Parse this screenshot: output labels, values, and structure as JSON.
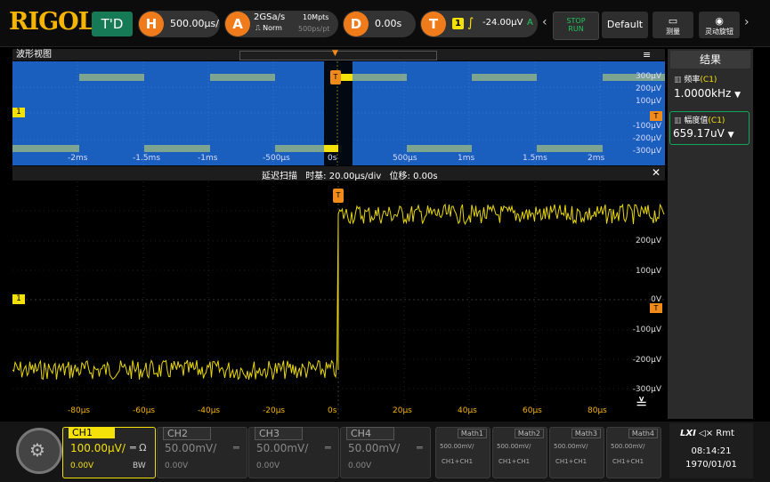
{
  "top": {
    "logo": "RIGOL",
    "td_label": "T'D",
    "horizontal": {
      "badge": "H",
      "value": "500.00μs/"
    },
    "acquire": {
      "badge": "A",
      "sample_rate": "2GSa/s",
      "mode": "Norm",
      "depth": "10Mpts",
      "per_pt": "500ps/pt"
    },
    "delay": {
      "badge": "D",
      "value": "0.00s"
    },
    "trigger": {
      "badge": "T",
      "source": "1",
      "level": "-24.00μV",
      "mode_letter": "A"
    },
    "stop_run": {
      "line1": "STOP",
      "line2": "RUN"
    },
    "default_label": "Default",
    "measure_label": "测量",
    "knob_label": "灵动旋钮",
    "colors": {
      "ch1": "#f5e10a",
      "trigger": "#f08a1a",
      "brand": "#f5b400",
      "overview_bg": "#1a5fbe",
      "measure_green": "#12a65a"
    }
  },
  "overview": {
    "title": "波形视图",
    "x_labels": [
      "-2ms",
      "-1.5ms",
      "-1ms",
      "-500μs",
      "0s",
      "500μs",
      "1ms",
      "1.5ms",
      "2ms"
    ],
    "y_labels": [
      "300μV",
      "200μV",
      "100μV",
      "-100μV",
      "-200μV",
      "-300μV"
    ],
    "ch_marker": "1",
    "trig_marker": "T"
  },
  "zoom": {
    "title": "延迟扫描",
    "timebase": "时基: 20.00μs/div",
    "offset": "位移: 0.00s",
    "x_labels": [
      "-80μs",
      "-60μs",
      "-40μs",
      "-20μs",
      "0s",
      "20μs",
      "40μs",
      "60μs",
      "80μs"
    ],
    "y_labels": [
      "200μV",
      "100μV",
      "0V",
      "-100μV",
      "-200μV",
      "-300μV"
    ],
    "ch_marker": "1",
    "trig_marker": "T"
  },
  "results": {
    "title": "结果",
    "items": [
      {
        "label": "频率",
        "src": "(C1)",
        "value": "1.0000kHz"
      },
      {
        "label": "幅度值",
        "src": "(C1)",
        "value": "659.17uV"
      }
    ]
  },
  "channels": [
    {
      "name": "CH1",
      "scale": "100.00μV/",
      "coupling": "═ Ω",
      "offset": "0.00V",
      "extra": "BW"
    },
    {
      "name": "CH2",
      "scale": "50.00mV/",
      "coupling": "═",
      "offset": "0.00V",
      "extra": ""
    },
    {
      "name": "CH3",
      "scale": "50.00mV/",
      "coupling": "═",
      "offset": "0.00V",
      "extra": ""
    },
    {
      "name": "CH4",
      "scale": "50.00mV/",
      "coupling": "═",
      "offset": "0.00V",
      "extra": ""
    }
  ],
  "maths": [
    {
      "name": "Math1",
      "scale": "500.00mV/",
      "expr": "CH1+CH1"
    },
    {
      "name": "Math2",
      "scale": "500.00mV/",
      "expr": "CH1+CH1"
    },
    {
      "name": "Math3",
      "scale": "500.00mV/",
      "expr": "CH1+CH1"
    },
    {
      "name": "Math4",
      "scale": "500.00mV/",
      "expr": "CH1+CH1"
    }
  ],
  "status": {
    "lxi": "LXI",
    "sound": "◁×",
    "rmt": "Rmt",
    "time": "08:14:21",
    "date": "1970/01/01"
  }
}
